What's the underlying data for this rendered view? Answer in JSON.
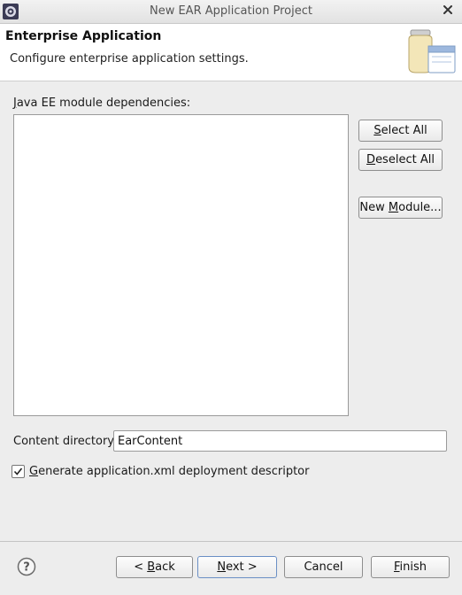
{
  "window": {
    "title": "New EAR Application Project"
  },
  "header": {
    "title": "Enterprise Application",
    "description": "Configure enterprise application settings.",
    "icon": "jar-window-icon"
  },
  "modules": {
    "label_mnemonic": "J",
    "label_rest": "ava EE module dependencies:",
    "items": []
  },
  "side_buttons": {
    "select_all": {
      "mn": "S",
      "rest": "elect All"
    },
    "deselect_all": {
      "mn": "D",
      "rest": "eselect All"
    },
    "new_module": {
      "pre": "New ",
      "mn": "M",
      "rest": "odule..."
    }
  },
  "content_directory": {
    "label": "Content directory:",
    "value": "EarContent"
  },
  "generate_descriptor": {
    "checked": true,
    "mn": "G",
    "rest": "enerate application.xml deployment descriptor"
  },
  "footer": {
    "back": {
      "pre": "< ",
      "mn": "B",
      "rest": "ack"
    },
    "next": {
      "mn": "N",
      "rest": "ext >"
    },
    "cancel": "Cancel",
    "finish": {
      "mn": "F",
      "rest": "inish"
    }
  },
  "colors": {
    "accent_default_button": "#6a8fc5",
    "separator": "#c4c4c4"
  }
}
